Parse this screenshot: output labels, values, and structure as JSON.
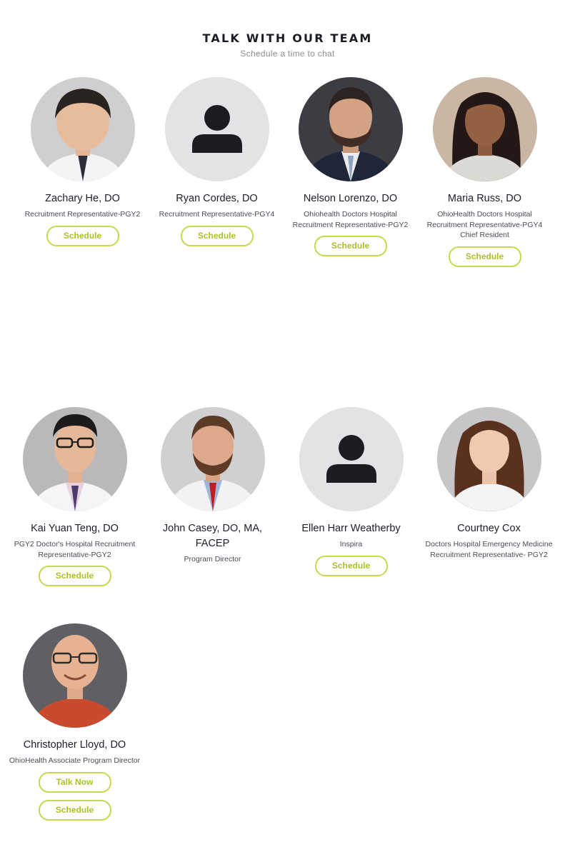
{
  "header": {
    "title": "TALK WITH OUR TEAM",
    "subtitle": "Schedule a time to chat"
  },
  "colors": {
    "accent": "#c5d94e",
    "accent_text": "#a9c22b",
    "placeholder_bg": "#e3e3e5",
    "placeholder_icon": "#1c1c22"
  },
  "team": [
    {
      "name": "Zachary He, DO",
      "role": "Recruitment Representative-PGY2",
      "button": "Schedule",
      "avatar": "photo"
    },
    {
      "name": "Ryan Cordes, DO",
      "role": "Recruitment Representative-PGY4",
      "button": "Schedule",
      "avatar": "placeholder-person-icon"
    },
    {
      "name": "Nelson Lorenzo, DO",
      "role": "Ohiohealth Doctors Hospital Recruitment Representative-PGY2",
      "button": "Schedule",
      "avatar": "photo"
    },
    {
      "name": "Maria Russ, DO",
      "role": "OhioHealth Doctors Hospital Recruitment Representative-PGY4 Chief Resident",
      "button": "Schedule",
      "avatar": "photo"
    },
    {
      "name": "Kai Yuan Teng, DO",
      "role": "PGY2 Doctor's Hospital Recruitment Representative-PGY2",
      "button": "Schedule",
      "avatar": "photo"
    },
    {
      "name": "John Casey, DO, MA, FACEP",
      "role": "Program Director",
      "avatar": "photo"
    },
    {
      "name": "Ellen Harr Weatherby",
      "role": "Inspira",
      "button": "Schedule",
      "avatar": "placeholder-person-icon"
    },
    {
      "name": "Courtney Cox",
      "role": "Doctors Hospital Emergency Medicine Recruitment Representative- PGY2",
      "avatar": "photo"
    },
    {
      "name": "Christopher Lloyd, DO",
      "role": "OhioHealth Associate Program Director",
      "button": "Talk Now",
      "button2": "Schedule",
      "avatar": "photo"
    }
  ]
}
